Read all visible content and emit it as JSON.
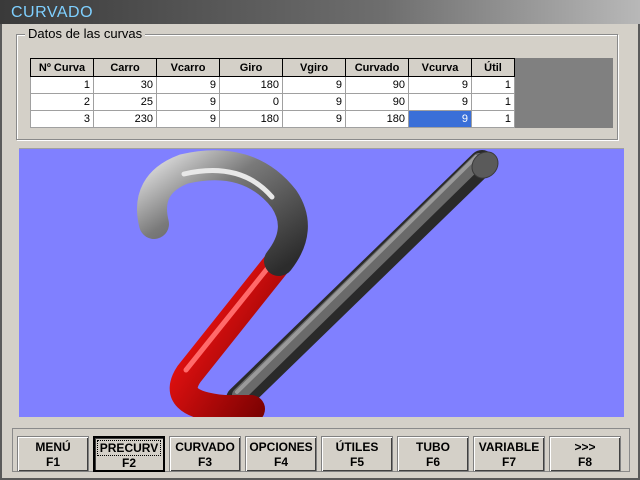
{
  "window": {
    "title": "CURVADO"
  },
  "group": {
    "legend": "Datos de las curvas"
  },
  "table": {
    "columns": [
      "Nº Curva",
      "Carro",
      "Vcarro",
      "Giro",
      "Vgiro",
      "Curvado",
      "Vcurva",
      "Útil"
    ],
    "rows": [
      [
        "1",
        "30",
        "9",
        "180",
        "9",
        "90",
        "9",
        "1"
      ],
      [
        "2",
        "25",
        "9",
        "0",
        "9",
        "90",
        "9",
        "1"
      ],
      [
        "3",
        "230",
        "9",
        "180",
        "9",
        "180",
        "9",
        "1"
      ]
    ],
    "selected_cell": {
      "row": 2,
      "col": 6
    }
  },
  "scene": {
    "background": "#8080ff",
    "tube_colors": {
      "straight": "#555555",
      "bend": "#d01010"
    }
  },
  "toolbar": {
    "buttons": [
      {
        "label": "MENÚ",
        "key": "F1"
      },
      {
        "label": "PRECURV",
        "key": "F2"
      },
      {
        "label": "CURVADO",
        "key": "F3"
      },
      {
        "label": "OPCIONES",
        "key": "F4"
      },
      {
        "label": "ÚTILES",
        "key": "F5"
      },
      {
        "label": "TUBO",
        "key": "F6"
      },
      {
        "label": "VARIABLE",
        "key": "F7"
      },
      {
        "label": ">>>",
        "key": "F8"
      }
    ],
    "active_index": 1
  }
}
